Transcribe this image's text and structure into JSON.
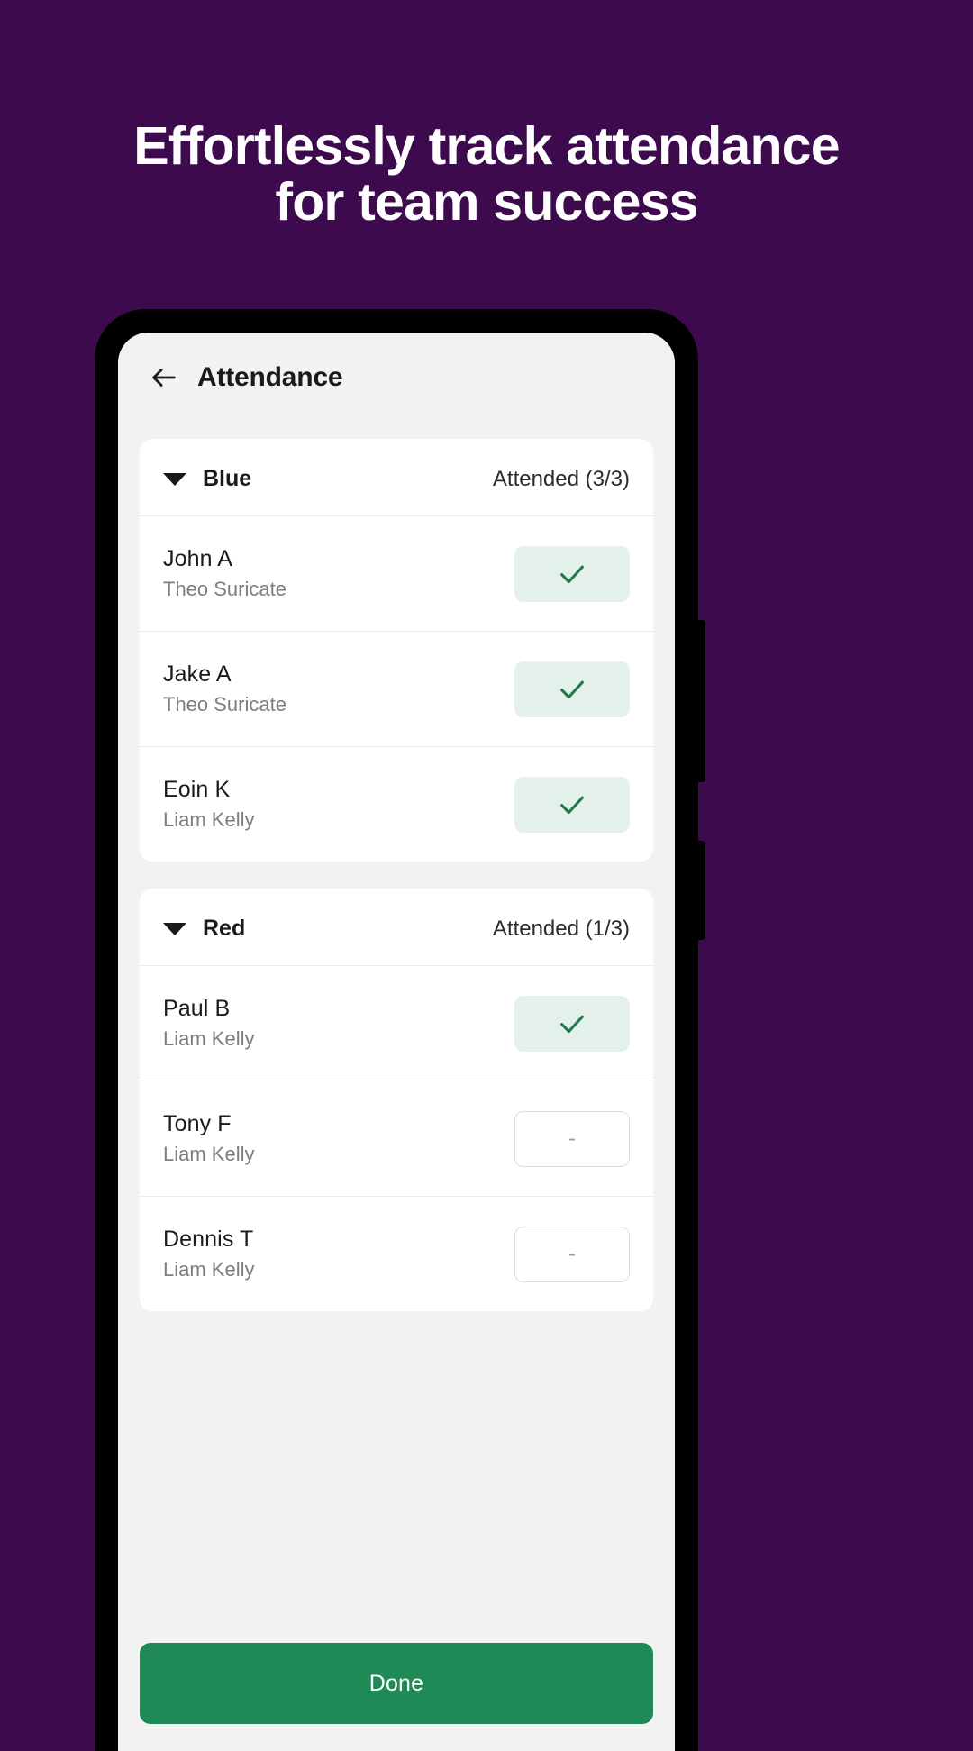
{
  "promo": {
    "headline_line1": "Effortlessly track attendance",
    "headline_line2": "for team success",
    "background_color": "#3D0A4E",
    "text_color": "#FFFFFF"
  },
  "app": {
    "appbar": {
      "back_icon": "arrow-left-icon",
      "title": "Attendance"
    },
    "groups": [
      {
        "name": "Blue",
        "caret_icon": "caret-down-icon",
        "count_label": "Attended (3/3)",
        "members": [
          {
            "name": "John A",
            "subtitle": "Theo Suricate",
            "status": "present",
            "status_icon": "check-icon",
            "status_label": ""
          },
          {
            "name": "Jake A",
            "subtitle": "Theo Suricate",
            "status": "present",
            "status_icon": "check-icon",
            "status_label": ""
          },
          {
            "name": "Eoin K",
            "subtitle": "Liam Kelly",
            "status": "present",
            "status_icon": "check-icon",
            "status_label": ""
          }
        ]
      },
      {
        "name": "Red",
        "caret_icon": "caret-down-icon",
        "count_label": "Attended (1/3)",
        "members": [
          {
            "name": "Paul B",
            "subtitle": "Liam Kelly",
            "status": "present",
            "status_icon": "check-icon",
            "status_label": ""
          },
          {
            "name": "Tony F",
            "subtitle": "Liam Kelly",
            "status": "absent",
            "status_icon": "dash-icon",
            "status_label": "-"
          },
          {
            "name": "Dennis T",
            "subtitle": "Liam Kelly",
            "status": "absent",
            "status_icon": "dash-icon",
            "status_label": "-"
          }
        ]
      }
    ],
    "footer": {
      "done_label": "Done"
    },
    "colors": {
      "present_bg": "#E4F0EA",
      "check_green": "#1F7A4D",
      "done_green": "#1F8A56",
      "screen_bg": "#F2F2F2",
      "card_bg": "#FFFFFF"
    }
  }
}
